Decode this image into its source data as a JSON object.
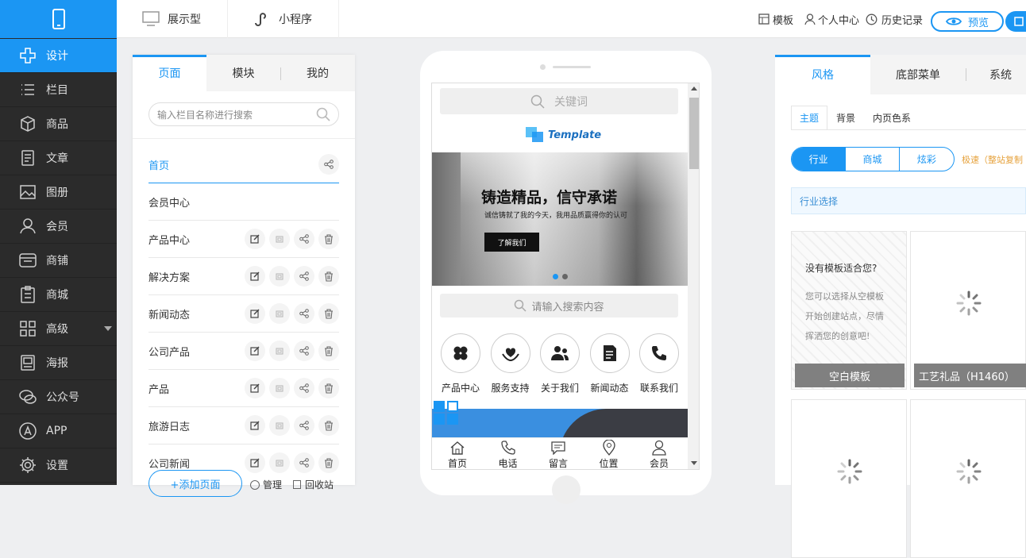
{
  "sidebar": {
    "items": [
      {
        "label": "设计",
        "icon": "design-icon"
      },
      {
        "label": "栏目",
        "icon": "list-icon"
      },
      {
        "label": "商品",
        "icon": "box-icon"
      },
      {
        "label": "文章",
        "icon": "document-icon"
      },
      {
        "label": "图册",
        "icon": "image-icon"
      },
      {
        "label": "会员",
        "icon": "user-icon"
      },
      {
        "label": "商铺",
        "icon": "shop-icon"
      },
      {
        "label": "商城",
        "icon": "clipboard-icon"
      },
      {
        "label": "高级",
        "icon": "grid-icon"
      },
      {
        "label": "海报",
        "icon": "poster-icon"
      },
      {
        "label": "公众号",
        "icon": "wechat-icon"
      },
      {
        "label": "APP",
        "icon": "app-icon"
      },
      {
        "label": "设置",
        "icon": "gear-icon"
      }
    ]
  },
  "topbar": {
    "tab_display": "展示型",
    "tab_miniprogram": "小程序",
    "templates": "模板",
    "personal_center": "个人中心",
    "history": "历史记录",
    "preview": "预览"
  },
  "left_panel": {
    "tabs": [
      "页面",
      "模块",
      "我的"
    ],
    "search_placeholder": "输入栏目名称进行搜索",
    "pages": [
      "首页",
      "会员中心",
      "产品中心",
      "解决方案",
      "新闻动态",
      "公司产品",
      "产品",
      "旅游日志",
      "公司新闻"
    ],
    "add_page": "+添加页面",
    "manage": "管理",
    "recycle": "回收站"
  },
  "phone": {
    "search_keyword": "关键词",
    "logo_text": "Template",
    "banner_title": "铸造精品，信守承诺",
    "banner_subtitle": "诚信铸就了我的今天，我用品质赢得你的认可",
    "banner_button": "了解我们",
    "search2": "请输入搜索内容",
    "nav": [
      "产品中心",
      "服务支持",
      "关于我们",
      "新闻动态",
      "联系我们"
    ],
    "bottom_nav": [
      "首页",
      "电话",
      "留言",
      "位置",
      "会员"
    ]
  },
  "right_panel": {
    "tabs": [
      "风格",
      "底部菜单",
      "系统"
    ],
    "subtabs": [
      "主题",
      "背景",
      "内页色系"
    ],
    "segments": [
      "行业",
      "商城",
      "炫彩"
    ],
    "speed_text": "极速（整站复制",
    "industry_select": "行业选择",
    "blank_question": "没有模板适合您?",
    "blank_desc1": "您可以选择从空模板",
    "blank_desc2": "开始创建站点，尽情",
    "blank_desc3": "挥洒您的创意吧!",
    "blank_template": "空白模板",
    "template2": "工艺礼品（H1460）"
  },
  "colors": {
    "accent": "#1b96f3",
    "sidebar": "#2b2b2b"
  }
}
